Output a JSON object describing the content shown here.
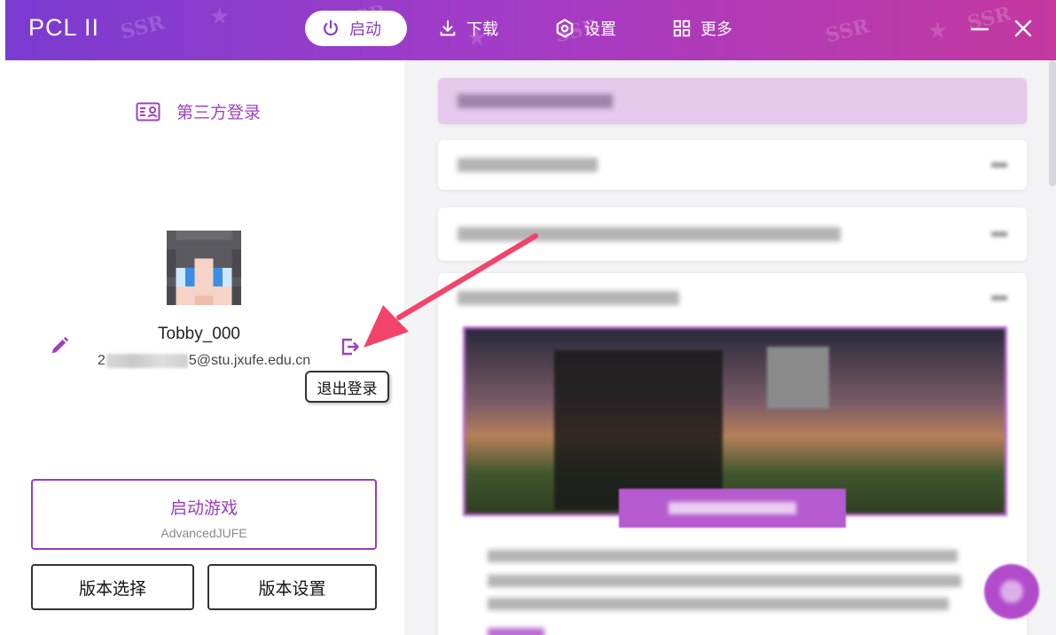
{
  "app": {
    "title": "PCL II"
  },
  "nav": [
    {
      "label": "启动",
      "icon": "power-icon",
      "active": true
    },
    {
      "label": "下载",
      "icon": "download-icon",
      "active": false
    },
    {
      "label": "设置",
      "icon": "settings-icon",
      "active": false
    },
    {
      "label": "更多",
      "icon": "grid-icon",
      "active": false
    }
  ],
  "window": {
    "minimize_icon": "minimize-icon",
    "close_icon": "close-icon"
  },
  "account": {
    "login_type": "第三方登录",
    "username": "Tobby_000",
    "email_prefix": "2",
    "email_domain": "5@stu.jxufe.edu.cn",
    "logout_tooltip": "退出登录"
  },
  "launch": {
    "title": "启动游戏",
    "version": "AdvancedJUFE"
  },
  "buttons": {
    "select_version": "版本选择",
    "version_settings": "版本设置"
  },
  "colors": {
    "accent": "#9b3bbf",
    "title_start": "#7a3bd0",
    "title_end": "#c4389f"
  }
}
